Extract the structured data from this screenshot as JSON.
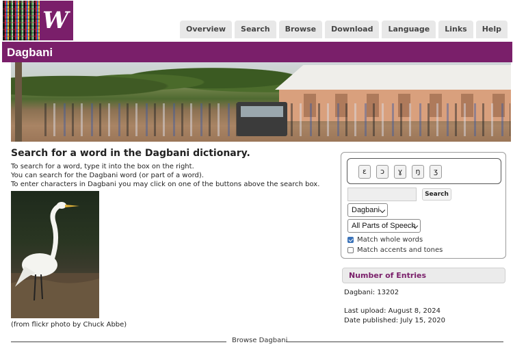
{
  "header": {
    "logo_letter": "W",
    "nav": [
      "Overview",
      "Search",
      "Browse",
      "Download",
      "Language",
      "Links",
      "Help"
    ]
  },
  "title": "Dagbani",
  "main": {
    "heading": "Search for a word in the Dagbani dictionary.",
    "intro_lines": [
      "To search for a word, type it into the box on the right.",
      "You can search for the Dagbani word (or part of a word).",
      "To enter characters in Dagbani you may click on one of the buttons above the search box."
    ],
    "photo_credit": "(from flickr photo by Chuck Abbe)",
    "browse_label": "Browse Dagbani"
  },
  "search": {
    "char_buttons": [
      "ɛ",
      "ɔ",
      "ɣ",
      "ŋ",
      "ʒ"
    ],
    "input_value": "",
    "button_label": "Search",
    "language_select": "Dagbani",
    "pos_select": "All Parts of Speech",
    "match_whole_words": {
      "label": "Match whole words",
      "checked": true
    },
    "match_accents": {
      "label": "Match accents and tones",
      "checked": false
    }
  },
  "entries": {
    "heading": "Number of Entries",
    "count_line": "Dagbani: 13202",
    "last_upload": "Last upload: August 8, 2024",
    "date_published": "Date published: July 15, 2020"
  },
  "colors": {
    "brand": "#7a1f6a",
    "nav_bg": "#e8e8e8"
  }
}
